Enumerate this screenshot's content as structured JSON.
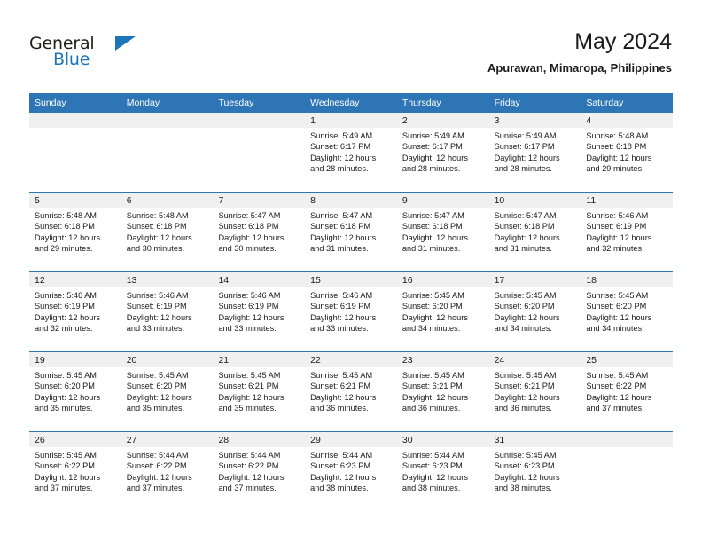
{
  "logo": {
    "word_one": "General",
    "word_two": "Blue",
    "triangle_color": "#1b75bb",
    "icon": "triangle-icon"
  },
  "header": {
    "title": "May 2024",
    "subtitle": "Apurawan, Mimaropa, Philippines"
  },
  "theme": {
    "header_blue": "#2e75b6",
    "date_band_gray": "#f0f0f0",
    "text": "#1a1a1a"
  },
  "calendar": {
    "weekdays": [
      "Sunday",
      "Monday",
      "Tuesday",
      "Wednesday",
      "Thursday",
      "Friday",
      "Saturday"
    ],
    "weeks": [
      [
        {
          "date": "",
          "empty": true
        },
        {
          "date": "",
          "empty": true
        },
        {
          "date": "",
          "empty": true
        },
        {
          "date": "1",
          "sunrise": "Sunrise: 5:49 AM",
          "sunset": "Sunset: 6:17 PM",
          "daylight1": "Daylight: 12 hours",
          "daylight2": "and 28 minutes."
        },
        {
          "date": "2",
          "sunrise": "Sunrise: 5:49 AM",
          "sunset": "Sunset: 6:17 PM",
          "daylight1": "Daylight: 12 hours",
          "daylight2": "and 28 minutes."
        },
        {
          "date": "3",
          "sunrise": "Sunrise: 5:49 AM",
          "sunset": "Sunset: 6:17 PM",
          "daylight1": "Daylight: 12 hours",
          "daylight2": "and 28 minutes."
        },
        {
          "date": "4",
          "sunrise": "Sunrise: 5:48 AM",
          "sunset": "Sunset: 6:18 PM",
          "daylight1": "Daylight: 12 hours",
          "daylight2": "and 29 minutes."
        }
      ],
      [
        {
          "date": "5",
          "sunrise": "Sunrise: 5:48 AM",
          "sunset": "Sunset: 6:18 PM",
          "daylight1": "Daylight: 12 hours",
          "daylight2": "and 29 minutes."
        },
        {
          "date": "6",
          "sunrise": "Sunrise: 5:48 AM",
          "sunset": "Sunset: 6:18 PM",
          "daylight1": "Daylight: 12 hours",
          "daylight2": "and 30 minutes."
        },
        {
          "date": "7",
          "sunrise": "Sunrise: 5:47 AM",
          "sunset": "Sunset: 6:18 PM",
          "daylight1": "Daylight: 12 hours",
          "daylight2": "and 30 minutes."
        },
        {
          "date": "8",
          "sunrise": "Sunrise: 5:47 AM",
          "sunset": "Sunset: 6:18 PM",
          "daylight1": "Daylight: 12 hours",
          "daylight2": "and 31 minutes."
        },
        {
          "date": "9",
          "sunrise": "Sunrise: 5:47 AM",
          "sunset": "Sunset: 6:18 PM",
          "daylight1": "Daylight: 12 hours",
          "daylight2": "and 31 minutes."
        },
        {
          "date": "10",
          "sunrise": "Sunrise: 5:47 AM",
          "sunset": "Sunset: 6:18 PM",
          "daylight1": "Daylight: 12 hours",
          "daylight2": "and 31 minutes."
        },
        {
          "date": "11",
          "sunrise": "Sunrise: 5:46 AM",
          "sunset": "Sunset: 6:19 PM",
          "daylight1": "Daylight: 12 hours",
          "daylight2": "and 32 minutes."
        }
      ],
      [
        {
          "date": "12",
          "sunrise": "Sunrise: 5:46 AM",
          "sunset": "Sunset: 6:19 PM",
          "daylight1": "Daylight: 12 hours",
          "daylight2": "and 32 minutes."
        },
        {
          "date": "13",
          "sunrise": "Sunrise: 5:46 AM",
          "sunset": "Sunset: 6:19 PM",
          "daylight1": "Daylight: 12 hours",
          "daylight2": "and 33 minutes."
        },
        {
          "date": "14",
          "sunrise": "Sunrise: 5:46 AM",
          "sunset": "Sunset: 6:19 PM",
          "daylight1": "Daylight: 12 hours",
          "daylight2": "and 33 minutes."
        },
        {
          "date": "15",
          "sunrise": "Sunrise: 5:46 AM",
          "sunset": "Sunset: 6:19 PM",
          "daylight1": "Daylight: 12 hours",
          "daylight2": "and 33 minutes."
        },
        {
          "date": "16",
          "sunrise": "Sunrise: 5:45 AM",
          "sunset": "Sunset: 6:20 PM",
          "daylight1": "Daylight: 12 hours",
          "daylight2": "and 34 minutes."
        },
        {
          "date": "17",
          "sunrise": "Sunrise: 5:45 AM",
          "sunset": "Sunset: 6:20 PM",
          "daylight1": "Daylight: 12 hours",
          "daylight2": "and 34 minutes."
        },
        {
          "date": "18",
          "sunrise": "Sunrise: 5:45 AM",
          "sunset": "Sunset: 6:20 PM",
          "daylight1": "Daylight: 12 hours",
          "daylight2": "and 34 minutes."
        }
      ],
      [
        {
          "date": "19",
          "sunrise": "Sunrise: 5:45 AM",
          "sunset": "Sunset: 6:20 PM",
          "daylight1": "Daylight: 12 hours",
          "daylight2": "and 35 minutes."
        },
        {
          "date": "20",
          "sunrise": "Sunrise: 5:45 AM",
          "sunset": "Sunset: 6:20 PM",
          "daylight1": "Daylight: 12 hours",
          "daylight2": "and 35 minutes."
        },
        {
          "date": "21",
          "sunrise": "Sunrise: 5:45 AM",
          "sunset": "Sunset: 6:21 PM",
          "daylight1": "Daylight: 12 hours",
          "daylight2": "and 35 minutes."
        },
        {
          "date": "22",
          "sunrise": "Sunrise: 5:45 AM",
          "sunset": "Sunset: 6:21 PM",
          "daylight1": "Daylight: 12 hours",
          "daylight2": "and 36 minutes."
        },
        {
          "date": "23",
          "sunrise": "Sunrise: 5:45 AM",
          "sunset": "Sunset: 6:21 PM",
          "daylight1": "Daylight: 12 hours",
          "daylight2": "and 36 minutes."
        },
        {
          "date": "24",
          "sunrise": "Sunrise: 5:45 AM",
          "sunset": "Sunset: 6:21 PM",
          "daylight1": "Daylight: 12 hours",
          "daylight2": "and 36 minutes."
        },
        {
          "date": "25",
          "sunrise": "Sunrise: 5:45 AM",
          "sunset": "Sunset: 6:22 PM",
          "daylight1": "Daylight: 12 hours",
          "daylight2": "and 37 minutes."
        }
      ],
      [
        {
          "date": "26",
          "sunrise": "Sunrise: 5:45 AM",
          "sunset": "Sunset: 6:22 PM",
          "daylight1": "Daylight: 12 hours",
          "daylight2": "and 37 minutes."
        },
        {
          "date": "27",
          "sunrise": "Sunrise: 5:44 AM",
          "sunset": "Sunset: 6:22 PM",
          "daylight1": "Daylight: 12 hours",
          "daylight2": "and 37 minutes."
        },
        {
          "date": "28",
          "sunrise": "Sunrise: 5:44 AM",
          "sunset": "Sunset: 6:22 PM",
          "daylight1": "Daylight: 12 hours",
          "daylight2": "and 37 minutes."
        },
        {
          "date": "29",
          "sunrise": "Sunrise: 5:44 AM",
          "sunset": "Sunset: 6:23 PM",
          "daylight1": "Daylight: 12 hours",
          "daylight2": "and 38 minutes."
        },
        {
          "date": "30",
          "sunrise": "Sunrise: 5:44 AM",
          "sunset": "Sunset: 6:23 PM",
          "daylight1": "Daylight: 12 hours",
          "daylight2": "and 38 minutes."
        },
        {
          "date": "31",
          "sunrise": "Sunrise: 5:45 AM",
          "sunset": "Sunset: 6:23 PM",
          "daylight1": "Daylight: 12 hours",
          "daylight2": "and 38 minutes."
        },
        {
          "date": "",
          "empty": true
        }
      ]
    ]
  }
}
